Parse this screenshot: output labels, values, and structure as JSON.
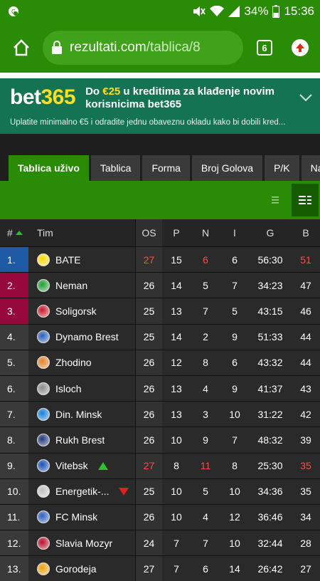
{
  "status": {
    "battery": "34%",
    "time": "15:36"
  },
  "browser": {
    "url_domain": "rezultati.com",
    "url_path": "/tablica/8",
    "tab_count": "6"
  },
  "banner": {
    "logo_main": "bet",
    "logo_accent": "365",
    "headline_pre": "Do ",
    "headline_amount": "€25",
    "headline_post": " u kreditima za klađenje novim korisnicima bet365",
    "subtext": "Uplatite minimalno €5 i odradite jednu obaveznu okladu kako bi dobili kred..."
  },
  "tabs": [
    "Tablica uživo",
    "Tablica",
    "Forma",
    "Broj Golova",
    "P/K",
    "Naj-st"
  ],
  "table": {
    "headers": {
      "rank": "#",
      "team": "Tim",
      "os": "OS",
      "p": "P",
      "n": "N",
      "i": "I",
      "g": "G",
      "b": "B"
    },
    "rows": [
      {
        "rank": "1.",
        "team": "BATE",
        "os": "27",
        "p": "15",
        "n": "6",
        "i": "6",
        "g": "56:30",
        "b": "51"
      },
      {
        "rank": "2.",
        "team": "Neman",
        "os": "26",
        "p": "14",
        "n": "5",
        "i": "7",
        "g": "34:23",
        "b": "47"
      },
      {
        "rank": "3.",
        "team": "Soligorsk",
        "os": "25",
        "p": "13",
        "n": "7",
        "i": "5",
        "g": "43:15",
        "b": "46"
      },
      {
        "rank": "4.",
        "team": "Dynamo Brest",
        "os": "25",
        "p": "14",
        "n": "2",
        "i": "9",
        "g": "51:33",
        "b": "44"
      },
      {
        "rank": "5.",
        "team": "Zhodino",
        "os": "26",
        "p": "12",
        "n": "8",
        "i": "6",
        "g": "43:32",
        "b": "44"
      },
      {
        "rank": "6.",
        "team": "Isloch",
        "os": "26",
        "p": "13",
        "n": "4",
        "i": "9",
        "g": "41:37",
        "b": "43"
      },
      {
        "rank": "7.",
        "team": "Din. Minsk",
        "os": "26",
        "p": "13",
        "n": "3",
        "i": "10",
        "g": "31:22",
        "b": "42"
      },
      {
        "rank": "8.",
        "team": "Rukh Brest",
        "os": "26",
        "p": "10",
        "n": "9",
        "i": "7",
        "g": "48:32",
        "b": "39"
      },
      {
        "rank": "9.",
        "team": "Vitebsk",
        "os": "27",
        "p": "8",
        "n": "11",
        "i": "8",
        "g": "25:30",
        "b": "35"
      },
      {
        "rank": "10.",
        "team": "Energetik-...",
        "os": "25",
        "p": "10",
        "n": "5",
        "i": "10",
        "g": "34:36",
        "b": "35"
      },
      {
        "rank": "11.",
        "team": "FC Minsk",
        "os": "26",
        "p": "10",
        "n": "4",
        "i": "12",
        "g": "36:46",
        "b": "34"
      },
      {
        "rank": "12.",
        "team": "Slavia Mozyr",
        "os": "24",
        "p": "7",
        "n": "7",
        "i": "10",
        "g": "32:44",
        "b": "28"
      },
      {
        "rank": "13.",
        "team": "Gorodeja",
        "os": "27",
        "p": "7",
        "n": "6",
        "i": "14",
        "g": "26:42",
        "b": "27"
      }
    ]
  },
  "colors": {
    "green": "#2a8b06",
    "champions": "#1e5aa6",
    "europa": "#96073c",
    "live_red": "#ff4a4a"
  }
}
